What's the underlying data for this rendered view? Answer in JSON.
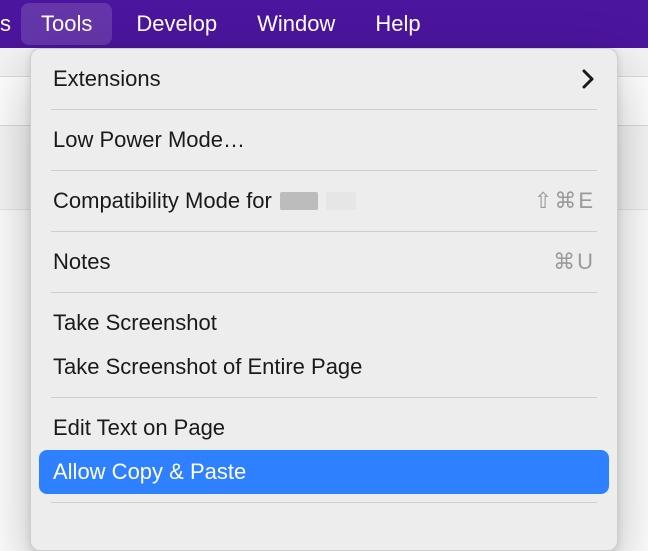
{
  "colors": {
    "menubar_bg": "#4b159d",
    "highlight": "#2f80ff",
    "dropdown_bg": "#ededed",
    "shortcut_text": "#9a9a9a"
  },
  "menubar": {
    "partial_left": "s",
    "items": [
      {
        "label": "Tools",
        "active": true
      },
      {
        "label": "Develop",
        "active": false
      },
      {
        "label": "Window",
        "active": false
      },
      {
        "label": "Help",
        "active": false
      }
    ]
  },
  "dropdown": {
    "items": [
      {
        "label": "Extensions",
        "submenu": true
      },
      {
        "sep": true
      },
      {
        "label": "Low Power Mode…"
      },
      {
        "sep": true
      },
      {
        "label": "Compatibility Mode for",
        "redacted_suffix": true,
        "shortcut": "⇧⌘E"
      },
      {
        "sep": true
      },
      {
        "label": "Notes",
        "shortcut": "⌘U"
      },
      {
        "sep": true
      },
      {
        "label": "Take Screenshot"
      },
      {
        "label": "Take Screenshot of Entire Page"
      },
      {
        "sep": true
      },
      {
        "label": "Edit Text on Page"
      },
      {
        "label": "Allow Copy & Paste",
        "highlight": true
      },
      {
        "sep": true
      }
    ]
  }
}
